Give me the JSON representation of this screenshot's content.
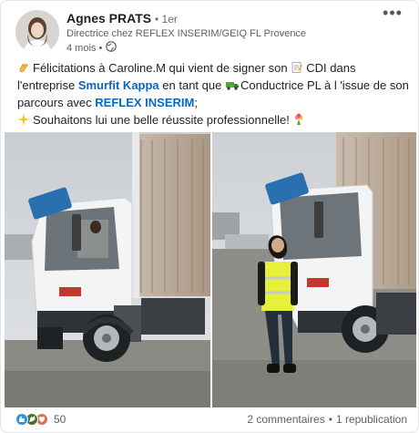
{
  "author": {
    "name": "Agnes PRATS",
    "degree": "• 1er",
    "headline": "Directrice chez REFLEX INSERIM/GEIQ FL Provence",
    "time": "4 mois •"
  },
  "post": {
    "line1_pre": "Félicitations à Caroline.M qui vient de signer son",
    "line1_post": "CDI dans",
    "line2_pre": "l'entreprise",
    "company": "Smurfit Kappa",
    "line2_mid": "en tant que",
    "line2_post": "Conductrice PL à l 'issue de son",
    "line3_pre": "parcours avec",
    "org": "REFLEX INSERIM",
    "line3_post": ";",
    "line4": "Souhaitons lui une belle réussite professionnelle!"
  },
  "social": {
    "reaction_count": "50",
    "comments": "2 commentaires",
    "separator": "•",
    "reposts": "1 republication"
  },
  "icons": {
    "more": "more-options-icon",
    "globe": "globe-icon",
    "like": "like-reaction-icon",
    "celebrate": "celebrate-reaction-icon",
    "support": "support-reaction-icon"
  },
  "colors": {
    "link": "#0a66c2",
    "like": "#378fe9",
    "celebrate": "#44712e",
    "support": "#df704d"
  }
}
